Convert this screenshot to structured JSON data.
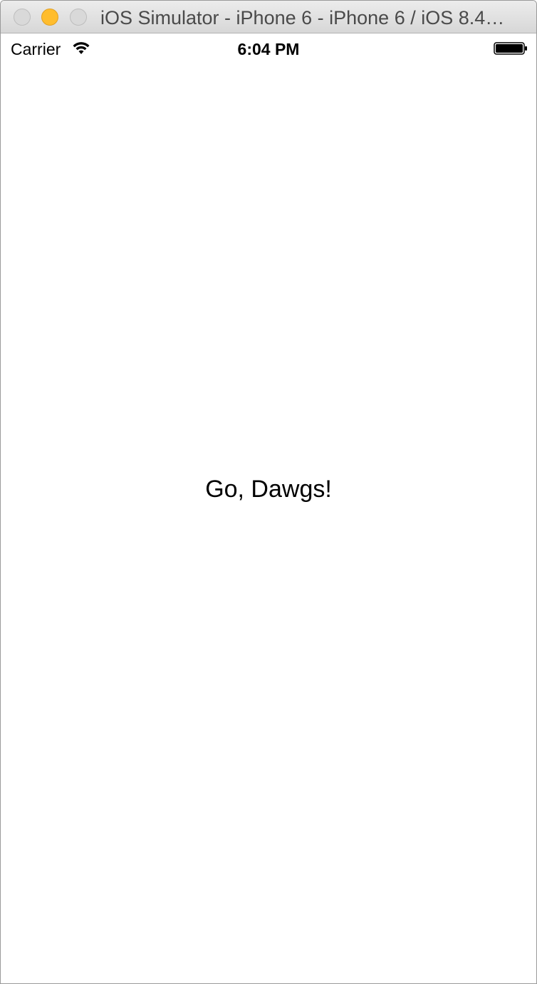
{
  "window": {
    "title": "iOS Simulator - iPhone 6 - iPhone 6 / iOS 8.4…"
  },
  "status_bar": {
    "carrier": "Carrier",
    "time": "6:04 PM",
    "icons": [
      "wifi-icon",
      "battery-icon"
    ]
  },
  "main": {
    "label": "Go, Dawgs!"
  },
  "colors": {
    "minimize": "#ffbd2e",
    "inactive_button": "#d9d9d9",
    "background": "#ffffff"
  }
}
